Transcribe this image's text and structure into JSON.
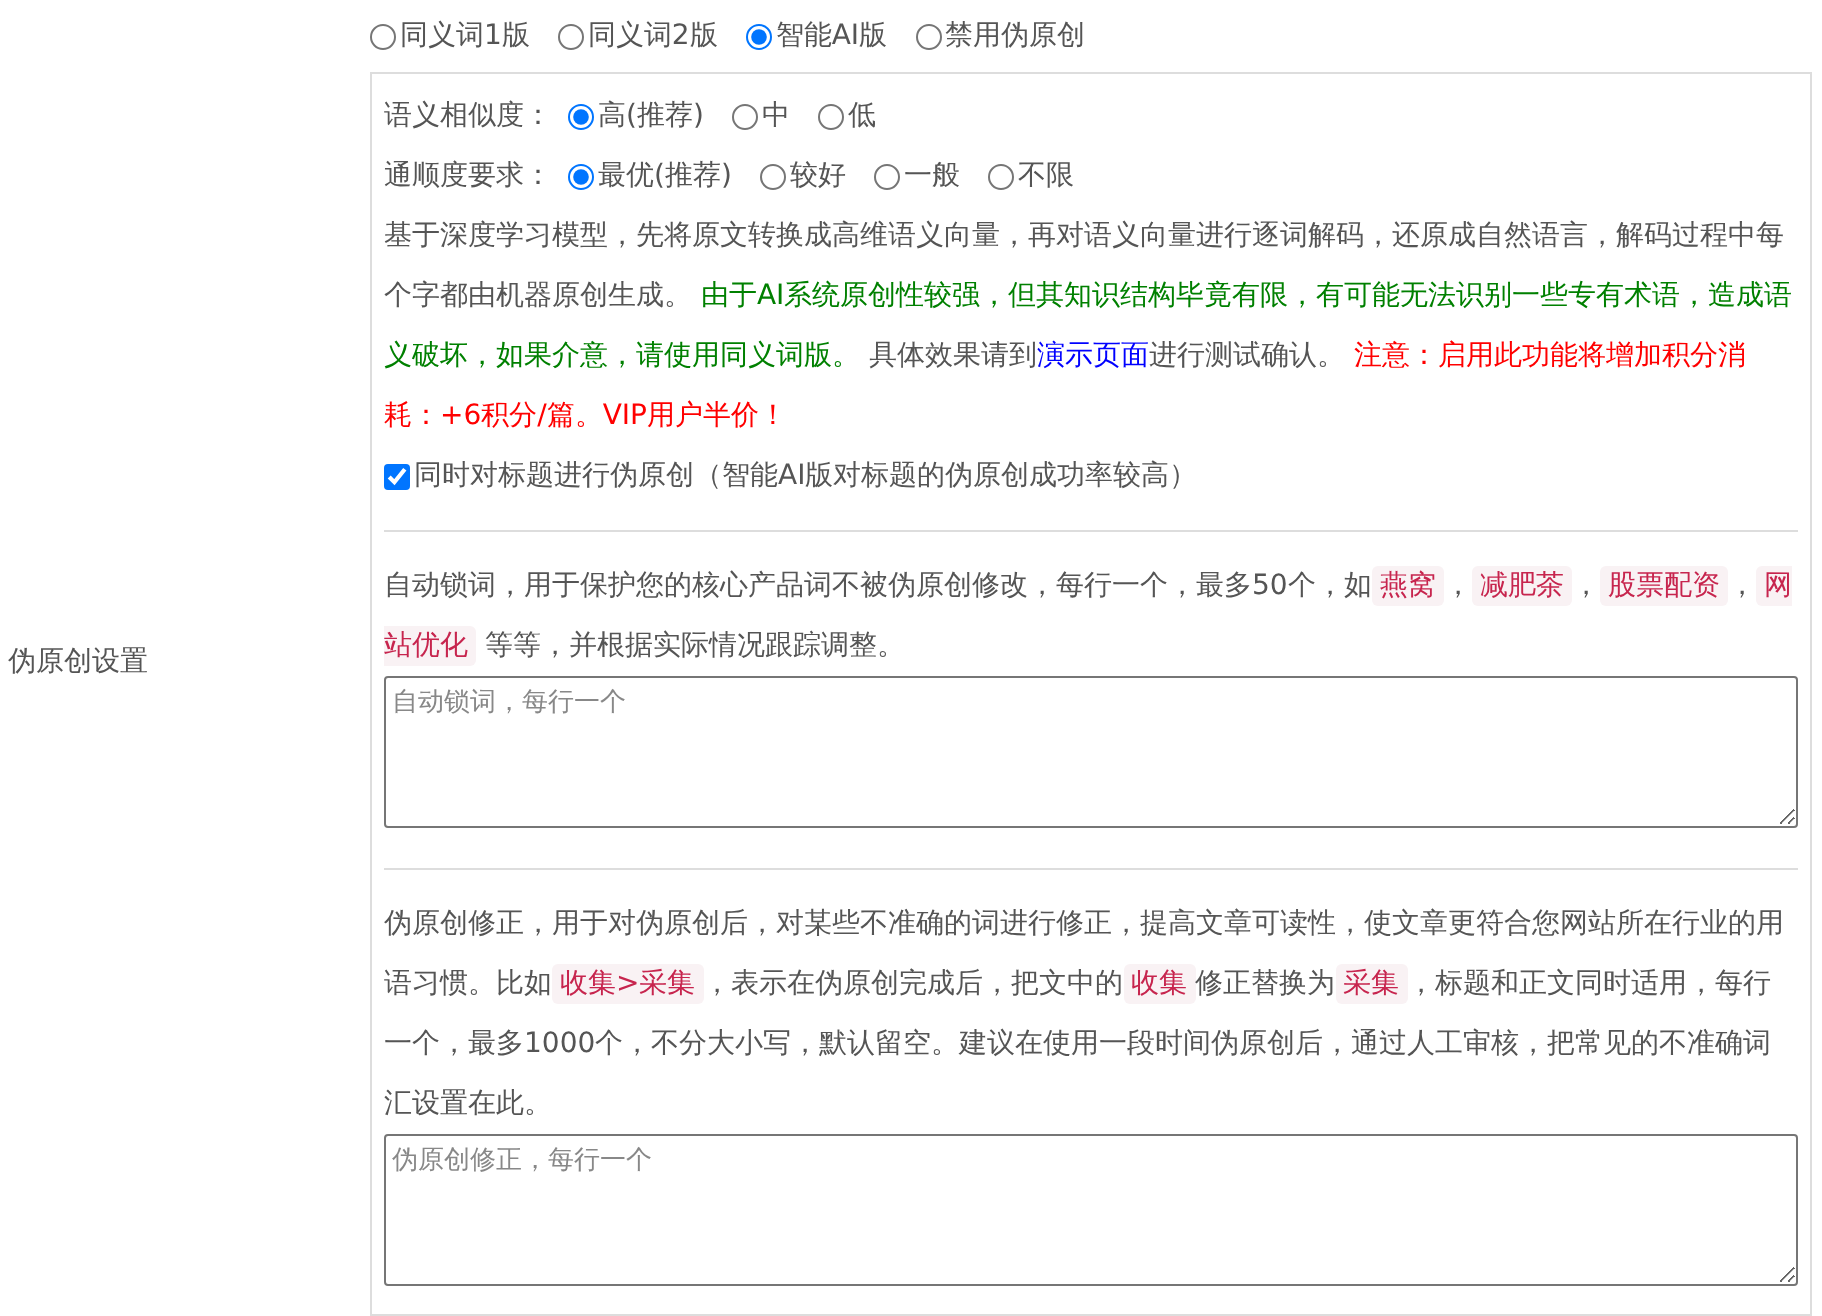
{
  "section_label": "伪原创设置",
  "modes": [
    {
      "label": "同义词1版",
      "selected": false
    },
    {
      "label": "同义词2版",
      "selected": false
    },
    {
      "label": "智能AI版",
      "selected": true
    },
    {
      "label": "禁用伪原创",
      "selected": false
    }
  ],
  "settings": [
    {
      "label": "语义相似度：",
      "options": [
        {
          "label": "高(推荐)",
          "selected": true
        },
        {
          "label": "中",
          "selected": false
        },
        {
          "label": "低",
          "selected": false
        }
      ]
    },
    {
      "label": "通顺度要求：",
      "options": [
        {
          "label": "最优(推荐)",
          "selected": true
        },
        {
          "label": "较好",
          "selected": false
        },
        {
          "label": "一般",
          "selected": false
        },
        {
          "label": "不限",
          "selected": false
        }
      ]
    }
  ],
  "ai_notice": [
    {
      "kind": "plain",
      "text": "基于深度学习模型，先将原文转换成高维语义向量，再对语义向量进行逐词解码，还原成自然语言，解码过程中每个字都由机器原创生成。 "
    },
    {
      "kind": "green",
      "text": "由于AI系统原创性较强，但其知识结构毕竟有限，有可能无法识别一些专有术语，造成语义破坏，如果介意，请使用同义词版。"
    },
    {
      "kind": "plain",
      "text": " 具体效果请到"
    },
    {
      "kind": "link",
      "text": "演示页面"
    },
    {
      "kind": "plain",
      "text": "进行测试确认。 "
    },
    {
      "kind": "red",
      "text": "注意：启用此功能将增加积分消耗：+6积分/篇。VIP用户半价！"
    }
  ],
  "title_option": {
    "label": "同时对标题进行伪原创（智能AI版对标题的伪原创成功率较高）",
    "checked": true
  },
  "lock_words": {
    "description": [
      {
        "kind": "plain",
        "text": "自动锁词，用于保护您的核心产品词不被伪原创修改，每行一个，最多50个，如"
      },
      {
        "kind": "code",
        "text": "燕窝"
      },
      {
        "kind": "plain",
        "text": "，"
      },
      {
        "kind": "code",
        "text": "减肥茶"
      },
      {
        "kind": "plain",
        "text": "，"
      },
      {
        "kind": "code",
        "text": "股票配资"
      },
      {
        "kind": "plain",
        "text": "，"
      },
      {
        "kind": "code",
        "text": "网站优化"
      },
      {
        "kind": "plain",
        "text": " 等等，并根据实际情况跟踪调整。"
      }
    ],
    "placeholder": "自动锁词，每行一个"
  },
  "corrections": {
    "description": [
      {
        "kind": "plain",
        "text": "伪原创修正，用于对伪原创后，对某些不准确的词进行修正，提高文章可读性，使文章更符合您网站所在行业的用语习惯。比如"
      },
      {
        "kind": "code",
        "text": "收集>采集"
      },
      {
        "kind": "plain",
        "text": "，表示在伪原创完成后，把文中的"
      },
      {
        "kind": "code",
        "text": "收集"
      },
      {
        "kind": "plain",
        "text": "修正替换为"
      },
      {
        "kind": "code",
        "text": "采集"
      },
      {
        "kind": "plain",
        "text": "，标题和正文同时适用，每行一个，最多1000个，不分大小写，默认留空。建议在使用一段时间伪原创后，通过人工审核，把常见的不准确词汇设置在此。"
      }
    ],
    "placeholder": "伪原创修正，每行一个"
  }
}
